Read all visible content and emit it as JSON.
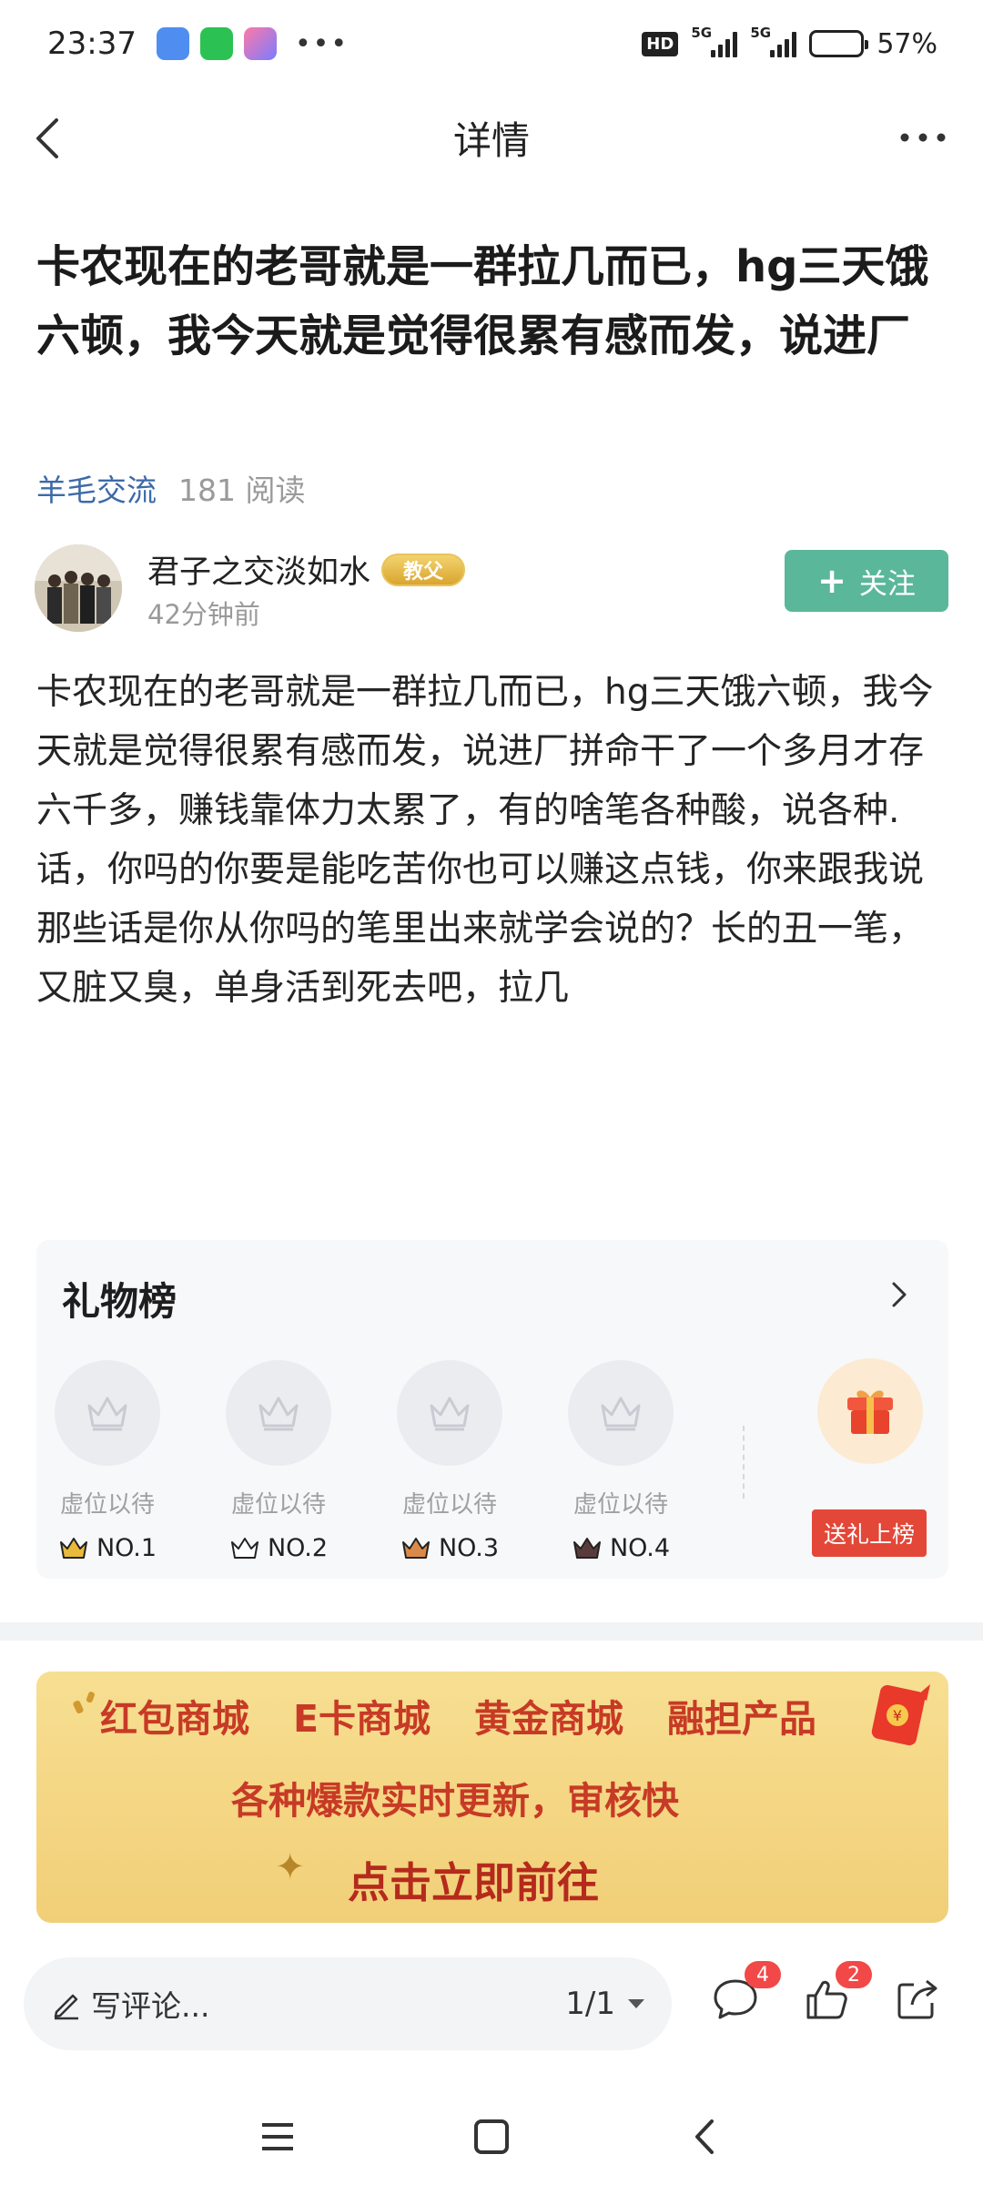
{
  "status_bar": {
    "time": "23:37",
    "more": "•••",
    "hd": "HD",
    "sig1": "5G",
    "sig2": "5G",
    "battery_level": 0.57,
    "battery": "57%"
  },
  "nav": {
    "title": "详情"
  },
  "post": {
    "title": "卡农现在的老哥就是一群拉几而已，hg三天饿六顿，我今天就是觉得很累有感而发，说进厂",
    "category": "羊毛交流",
    "reads": "181 阅读",
    "author": {
      "name": "君子之交淡如水",
      "badge": "教父",
      "time": "42分钟前"
    },
    "follow_label": "关注",
    "body": "卡农现在的老哥就是一群拉几而已，hg三天饿六顿，我今天就是觉得很累有感而发，说进厂拼命干了一个多月才存六千多，赚钱靠体力太累了，有的啥笔各种酸，说各种.话，你吗的你要是能吃苦你也可以赚这点钱，你来跟我说那些话是你从你吗的笔里出来就学会说的？长的丑一笔，又脏又臭，单身活到死去吧，拉几"
  },
  "gift": {
    "title": "礼物榜",
    "slots": [
      {
        "text": "虚位以待",
        "rank": "NO.1",
        "color": "#e8b93a"
      },
      {
        "text": "虚位以待",
        "rank": "NO.2",
        "color": "#6c7a8c"
      },
      {
        "text": "虚位以待",
        "rank": "NO.3",
        "color": "#d98a4a"
      },
      {
        "text": "虚位以待",
        "rank": "NO.4",
        "color": "#5a3b3b"
      }
    ],
    "send_label": "送礼上榜"
  },
  "banner": {
    "items": [
      "红包商城",
      "E卡商城",
      "黄金商城",
      "融担产品"
    ],
    "line2": "各种爆款实时更新，审核快",
    "cta": "点击立即前往"
  },
  "action_bar": {
    "comment_placeholder": "写评论...",
    "page": "1/1",
    "comment_count": "4",
    "like_count": "2"
  }
}
